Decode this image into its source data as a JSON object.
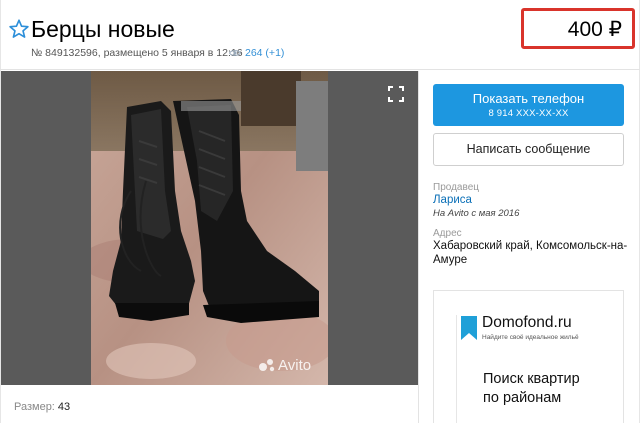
{
  "listing": {
    "title": "Берцы новые",
    "meta": "№ 849132596, размещено 5 января в 12:16",
    "views": "264 (+1)",
    "price": "400 ₽"
  },
  "photo": {
    "watermark": "Avito"
  },
  "attributes": [
    {
      "label": "Размер:",
      "value": "43"
    }
  ],
  "sidebar": {
    "phone_button_label": "Показать телефон",
    "phone_masked": "8 914 XXX-XX-XX",
    "message_button_label": "Написать сообщение",
    "seller_label": "Продавец",
    "seller_name": "Лариса",
    "seller_since": "На Avito с мая 2016",
    "address_label": "Адрес",
    "address_line1": "Хабаровский край, Комсомольск-на-",
    "address_line2": "Амуре"
  },
  "ad": {
    "logo_text": "Domofond.ru",
    "tagline": "Найдите своё идеальное жильё",
    "headline_line1": "Поиск квартир",
    "headline_line2": "по районам"
  },
  "colors": {
    "accent": "#1d97e0",
    "price_highlight": "#d9342b",
    "link": "#3390d6"
  }
}
